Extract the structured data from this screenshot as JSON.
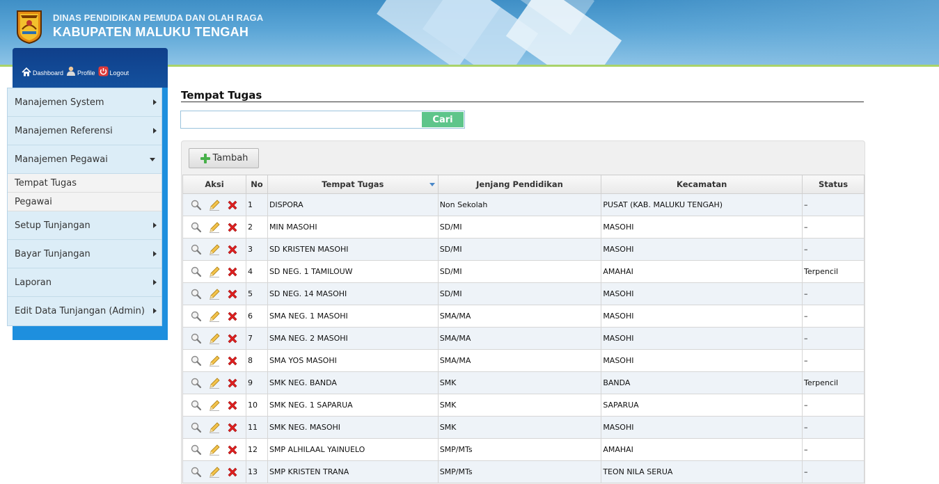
{
  "header": {
    "org_line1": "DINAS PENDIDIKAN PEMUDA DAN OLAH RAGA",
    "org_line2": "KABUPATEN MALUKU TENGAH"
  },
  "toplinks": [
    {
      "label": "Dashboard",
      "icon": "home-icon"
    },
    {
      "label": "Profile",
      "icon": "user-icon"
    },
    {
      "label": "Logout",
      "icon": "power-icon"
    }
  ],
  "menu": {
    "items": [
      {
        "label": "Manajemen System"
      },
      {
        "label": "Manajemen Referensi"
      },
      {
        "label": "Manajemen Pegawai"
      },
      {
        "label": "Setup Tunjangan"
      },
      {
        "label": "Bayar Tunjangan"
      },
      {
        "label": "Laporan"
      },
      {
        "label": "Edit Data Tunjangan (Admin)"
      }
    ],
    "sub_items": [
      {
        "label": "Tempat Tugas"
      },
      {
        "label": "Pegawai"
      }
    ]
  },
  "main": {
    "title": "Tempat Tugas",
    "search_value": "",
    "search_button": "Cari",
    "add_button": "Tambah"
  },
  "table": {
    "columns": [
      "Aksi",
      "No",
      "Tempat Tugas",
      "Jenjang Pendidikan",
      "Kecamatan",
      "Status"
    ],
    "rows": [
      {
        "no": "1",
        "tempat": "DISPORA",
        "jenjang": "Non Sekolah",
        "kecamatan": "PUSAT (KAB. MALUKU TENGAH)",
        "status": "–"
      },
      {
        "no": "2",
        "tempat": "MIN MASOHI",
        "jenjang": "SD/MI",
        "kecamatan": "MASOHI",
        "status": "–"
      },
      {
        "no": "3",
        "tempat": "SD KRISTEN MASOHI",
        "jenjang": "SD/MI",
        "kecamatan": "MASOHI",
        "status": "–"
      },
      {
        "no": "4",
        "tempat": "SD NEG. 1 TAMILOUW",
        "jenjang": "SD/MI",
        "kecamatan": "AMAHAI",
        "status": "Terpencil"
      },
      {
        "no": "5",
        "tempat": "SD NEG. 14 MASOHI",
        "jenjang": "SD/MI",
        "kecamatan": "MASOHI",
        "status": "–"
      },
      {
        "no": "6",
        "tempat": "SMA NEG. 1 MASOHI",
        "jenjang": "SMA/MA",
        "kecamatan": "MASOHI",
        "status": "–"
      },
      {
        "no": "7",
        "tempat": "SMA NEG. 2 MASOHI",
        "jenjang": "SMA/MA",
        "kecamatan": "MASOHI",
        "status": "–"
      },
      {
        "no": "8",
        "tempat": "SMA YOS MASOHI",
        "jenjang": "SMA/MA",
        "kecamatan": "MASOHI",
        "status": "–"
      },
      {
        "no": "9",
        "tempat": "SMK NEG. BANDA",
        "jenjang": "SMK",
        "kecamatan": "BANDA",
        "status": "Terpencil"
      },
      {
        "no": "10",
        "tempat": "SMK NEG. 1 SAPARUA",
        "jenjang": "SMK",
        "kecamatan": "SAPARUA",
        "status": "–"
      },
      {
        "no": "11",
        "tempat": "SMK NEG. MASOHI",
        "jenjang": "SMK",
        "kecamatan": "MASOHI",
        "status": "–"
      },
      {
        "no": "12",
        "tempat": "SMP ALHILAAL YAINUELO",
        "jenjang": "SMP/MTs",
        "kecamatan": "AMAHAI",
        "status": "–"
      },
      {
        "no": "13",
        "tempat": "SMP KRISTEN TRANA",
        "jenjang": "SMP/MTs",
        "kecamatan": "TEON NILA SERUA",
        "status": "–"
      }
    ]
  },
  "colors": {
    "header_blue": "#4a97cc",
    "menu_bg": "#dcedf7",
    "sidebar_blue": "#1e8fde",
    "search_button": "#5ec58a",
    "delete_red": "#e02020"
  }
}
